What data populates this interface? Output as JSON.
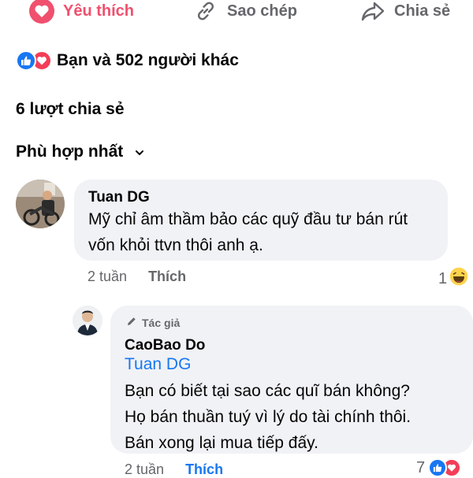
{
  "actions": {
    "like_label": "Yêu thích",
    "copy_label": "Sao chép",
    "share_label": "Chia sẻ"
  },
  "reactions": {
    "summary": "Bạn và 502 người khác"
  },
  "shares": {
    "text": "6 lượt chia sẻ"
  },
  "sort": {
    "label": "Phù hợp nhất"
  },
  "comments": [
    {
      "author": "Tuan DG",
      "lines": [
        "Mỹ chỉ âm thầm bảo các quỹ đầu tư bán rút",
        "vốn khỏi ttvn thôi anh ạ."
      ],
      "time": "2 tuần",
      "like_label": "Thích",
      "reaction_count": "1"
    },
    {
      "badge": "Tác giả",
      "author": "CaoBao Do",
      "mention": "Tuan DG",
      "lines": [
        "Bạn có biết tại sao các quĩ bán không?",
        "Họ bán thuần tuý vì lý do tài chính thôi.",
        "Bán xong lại mua tiếp đấy."
      ],
      "time": "2 tuần",
      "like_label": "Thích",
      "reaction_count": "7"
    }
  ],
  "colors": {
    "love": "#f0506e",
    "like_blue": "#1877f2",
    "muted": "#65676b",
    "bubble": "#f0f2f5"
  },
  "icons": {
    "like_action": "heart-icon",
    "copy_action": "link-icon",
    "share_action": "share-arrow-icon",
    "sort": "chevron-down-icon"
  }
}
